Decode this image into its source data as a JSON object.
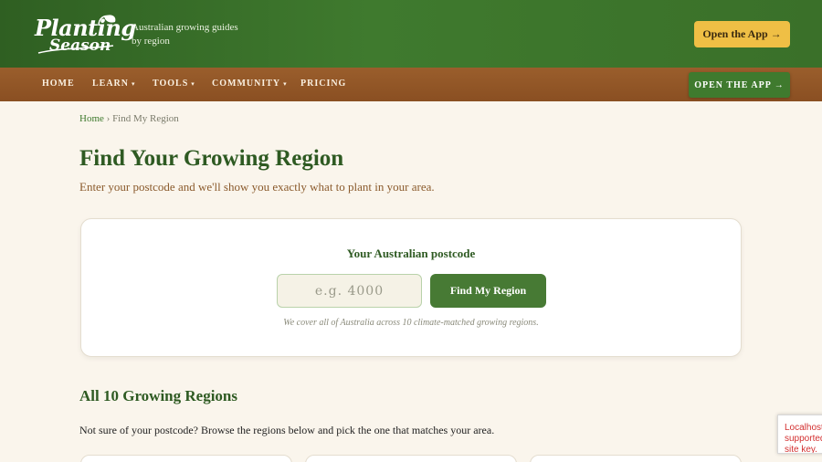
{
  "header": {
    "logo_line1": "Planting",
    "logo_line2": "Season",
    "tagline_line1": "Australian growing guides",
    "tagline_line2": "by region",
    "open_app_label": "Open the App →"
  },
  "nav": {
    "items": [
      {
        "label": "HOME",
        "has_caret": false
      },
      {
        "label": "LEARN",
        "has_caret": true
      },
      {
        "label": "TOOLS",
        "has_caret": true
      },
      {
        "label": "COMMUNITY",
        "has_caret": true
      },
      {
        "label": "PRICING",
        "has_caret": false
      }
    ],
    "caret": "▾",
    "open_app_label": "OPEN THE APP →"
  },
  "breadcrumb": {
    "home": "Home",
    "separator": "›",
    "current": "Find My Region"
  },
  "page": {
    "title": "Find Your Growing Region",
    "subtitle": "Enter your postcode and we'll show you exactly what to plant in your area."
  },
  "postcode_card": {
    "label": "Your Australian postcode",
    "input_value": "",
    "input_placeholder": "e.g. 4000",
    "button_label": "Find My Region",
    "note": "We cover all of Australia across 10 climate-matched growing regions."
  },
  "regions_section": {
    "title": "All 10 Growing Regions",
    "text": "Not sure of your postcode? Browse the regions below and pick the one that matches your area."
  },
  "recaptcha": {
    "lines": [
      "Localhost",
      "supported",
      "site key."
    ]
  },
  "colors": {
    "header_green": "#3f7a2e",
    "nav_brown": "#8a4f22",
    "accent_yellow": "#efbf45",
    "title_green": "#2e5a22",
    "subtitle_brown": "#8a5a2c",
    "page_background": "#faf5ec"
  }
}
